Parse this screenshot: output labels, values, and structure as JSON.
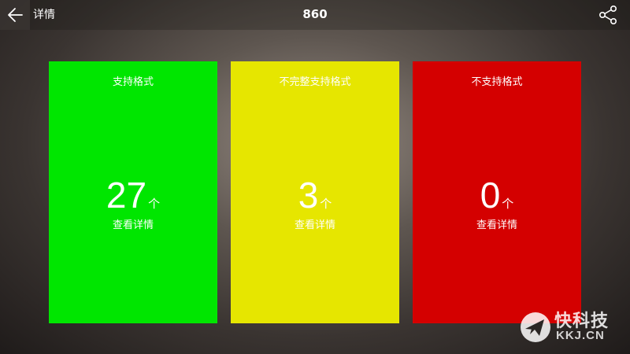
{
  "header": {
    "back_label": "详情",
    "title": "860"
  },
  "colors": {
    "supported": "#00e600",
    "partial": "#e6e600",
    "unsupported": "#d40000"
  },
  "cards": [
    {
      "label": "支持格式",
      "count": "27",
      "unit": "个",
      "link": "查看详情"
    },
    {
      "label": "不完整支持格式",
      "count": "3",
      "unit": "个",
      "link": "查看详情"
    },
    {
      "label": "不支持格式",
      "count": "0",
      "unit": "个",
      "link": "查看详情"
    }
  ],
  "watermark": {
    "cn": "快科技",
    "en": "KKJ.CN"
  }
}
